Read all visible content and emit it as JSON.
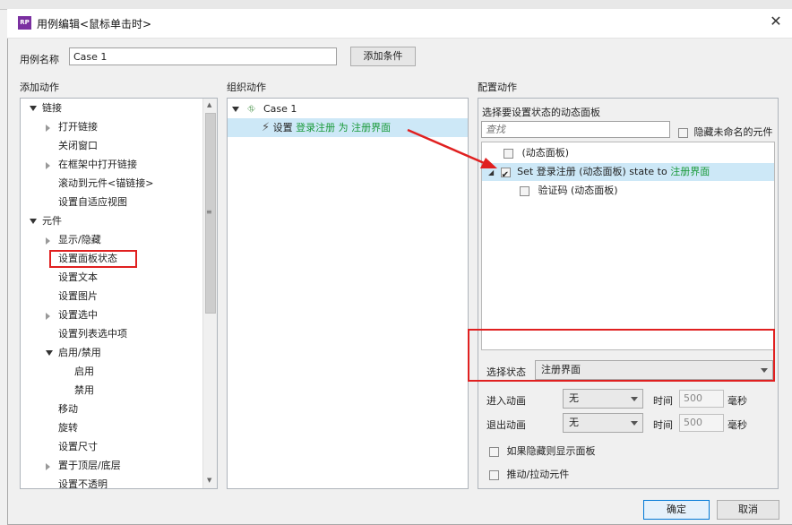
{
  "window": {
    "title": "用例编辑<鼠标单击时>",
    "app_icon_text": "RP"
  },
  "case_name": {
    "label": "用例名称",
    "value": "Case 1",
    "add_condition_label": "添加条件"
  },
  "add_actions": {
    "header": "添加动作",
    "items": [
      {
        "label": "链接",
        "level": 0,
        "expander": "down"
      },
      {
        "label": "打开链接",
        "level": 1,
        "expander": "right"
      },
      {
        "label": "关闭窗口",
        "level": 1,
        "expander": "none"
      },
      {
        "label": "在框架中打开链接",
        "level": 1,
        "expander": "right"
      },
      {
        "label": "滚动到元件<锚链接>",
        "level": 1,
        "expander": "none"
      },
      {
        "label": "设置自适应视图",
        "level": 1,
        "expander": "none"
      },
      {
        "label": "元件",
        "level": 0,
        "expander": "down"
      },
      {
        "label": "显示/隐藏",
        "level": 1,
        "expander": "right"
      },
      {
        "label": "设置面板状态",
        "level": 1,
        "expander": "none"
      },
      {
        "label": "设置文本",
        "level": 1,
        "expander": "none"
      },
      {
        "label": "设置图片",
        "level": 1,
        "expander": "none"
      },
      {
        "label": "设置选中",
        "level": 1,
        "expander": "right"
      },
      {
        "label": "设置列表选中项",
        "level": 1,
        "expander": "none"
      },
      {
        "label": "启用/禁用",
        "level": 1,
        "expander": "down"
      },
      {
        "label": "启用",
        "level": 2,
        "expander": "none"
      },
      {
        "label": "禁用",
        "level": 2,
        "expander": "none"
      },
      {
        "label": "移动",
        "level": 1,
        "expander": "none"
      },
      {
        "label": "旋转",
        "level": 1,
        "expander": "none"
      },
      {
        "label": "设置尺寸",
        "level": 1,
        "expander": "none"
      },
      {
        "label": "置于顶层/底层",
        "level": 1,
        "expander": "right"
      },
      {
        "label": "设置不透明",
        "level": 1,
        "expander": "none"
      }
    ]
  },
  "organize_actions": {
    "header": "组织动作",
    "case_label": "Case 1",
    "action": {
      "prefix": "设置 ",
      "target": "登录注册",
      "middle": " 为 ",
      "state": "注册界面"
    }
  },
  "configure_actions": {
    "header": "配置动作",
    "panel_title": "选择要设置状态的动态面板",
    "search_placeholder": "查找",
    "hide_unnamed_label": "隐藏未命名的元件",
    "tree": {
      "row1": "(动态面板)",
      "row2_prefix": "Set 登录注册 (动态面板) state to ",
      "row2_state": "注册界面",
      "row3": "验证码 (动态面板)"
    },
    "select_state_label": "选择状态",
    "select_state_value": "注册界面",
    "enter_anim_label": "进入动画",
    "enter_anim_value": "无",
    "exit_anim_label": "退出动画",
    "exit_anim_value": "无",
    "time_label": "时间",
    "time_value": "500",
    "ms_label": "毫秒",
    "show_if_hidden_label": "如果隐藏则显示面板",
    "push_pull_label": "推动/拉动元件"
  },
  "buttons": {
    "ok": "确定",
    "cancel": "取消"
  },
  "colors": {
    "highlight": "#cde8f7",
    "green_text": "#1a9a3a",
    "annotation_red": "#e02020"
  }
}
